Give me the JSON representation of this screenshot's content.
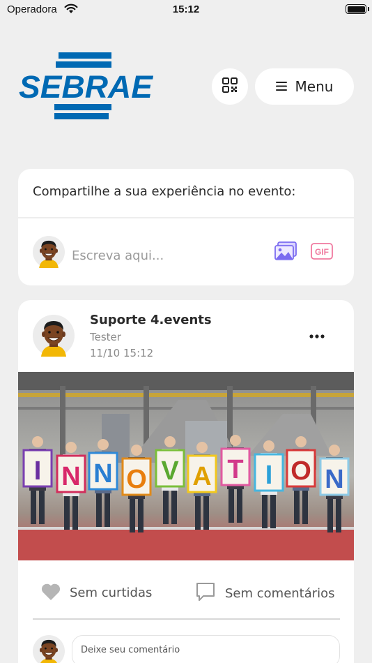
{
  "status_bar": {
    "carrier": "Operadora",
    "time": "15:12"
  },
  "header": {
    "logo_text": "SEBRAE",
    "brand_color": "#0069b3",
    "menu_label": "Menu"
  },
  "composer": {
    "title": "Compartilhe a sua experiência no evento:",
    "placeholder": "Escreva aqui...",
    "gif_label": "GIF",
    "image_icon_color": "#7b6cf0",
    "gif_icon_color": "#f07aa0"
  },
  "post": {
    "author": "Suporte 4.events",
    "role": "Tester",
    "timestamp": "11/10 15:12",
    "image_letters": [
      "I",
      "N",
      "N",
      "O",
      "V",
      "A",
      "T",
      "I",
      "O",
      "N"
    ],
    "likes_label": "Sem curtidas",
    "comments_label": "Sem comentários",
    "comment_placeholder": "Deixe seu comentário"
  }
}
